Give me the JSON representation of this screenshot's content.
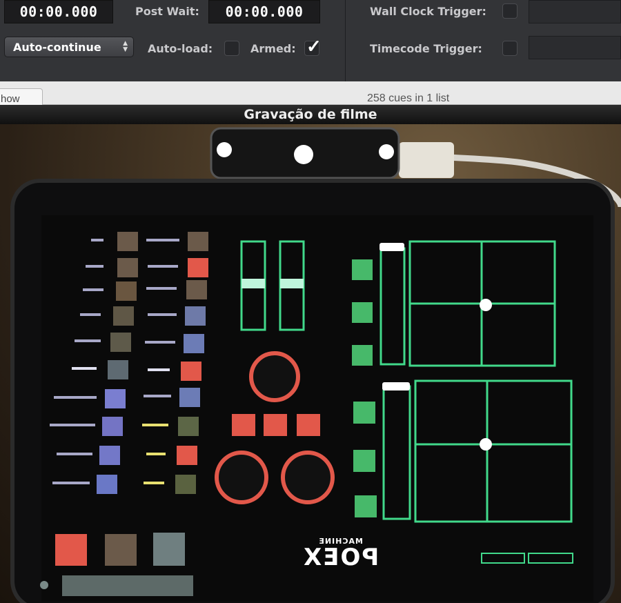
{
  "inspector": {
    "pre_wait": "00:00.000",
    "post_wait_label": "Post Wait:",
    "post_wait": "00:00.000",
    "continue_mode": "Auto-continue",
    "auto_load_label": "Auto-load:",
    "auto_load_checked": false,
    "armed_label": "Armed:",
    "armed_checked": true,
    "wall_clock_label": "Wall Clock Trigger:",
    "wall_clock_checked": false,
    "timecode_label": "Timecode Trigger:",
    "timecode_checked": false
  },
  "strip": {
    "button_label": "how",
    "cue_count": "258 cues in 1 list"
  },
  "movie": {
    "title": "Gravação de filme",
    "device_logo": "POEX",
    "device_logo_sub": "MACHINE",
    "colors": {
      "panel_green": "#41d98b",
      "button_red": "#e2584a",
      "button_green": "#47b96a"
    }
  }
}
